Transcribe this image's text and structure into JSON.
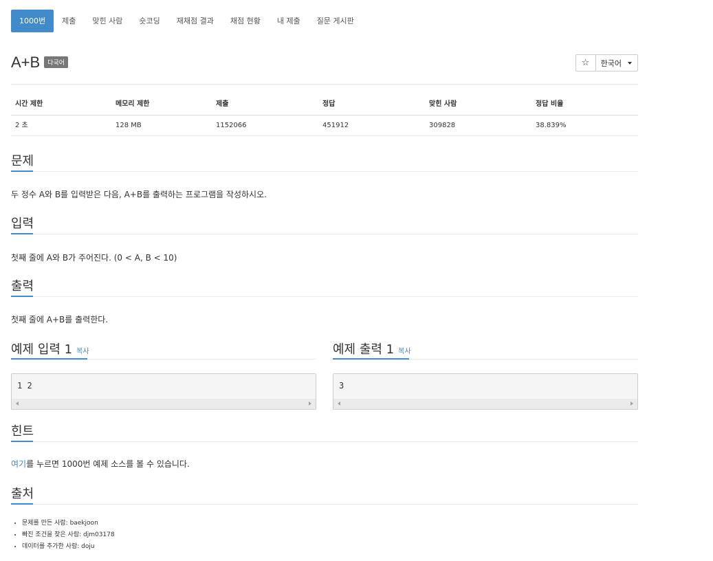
{
  "tabs": [
    {
      "label": "1000번",
      "active": true
    },
    {
      "label": "제출"
    },
    {
      "label": "맞힌 사람"
    },
    {
      "label": "숏코딩"
    },
    {
      "label": "재채점 결과"
    },
    {
      "label": "채점 현황"
    },
    {
      "label": "내 제출"
    },
    {
      "label": "질문 게시판"
    }
  ],
  "problem": {
    "title": "A+B",
    "badge": "다국어",
    "star_icon": "star-icon",
    "star_glyph": "☆",
    "language": "한국어"
  },
  "stats": {
    "headers": [
      "시간 제한",
      "메모리 제한",
      "제출",
      "정답",
      "맞힌 사람",
      "정답 비율"
    ],
    "values": [
      "2 초",
      "128 MB",
      "1152066",
      "451912",
      "309828",
      "38.839%"
    ]
  },
  "sections": {
    "problem": {
      "title": "문제",
      "text": "두 정수 A와 B를 입력받은 다음, A+B를 출력하는 프로그램을 작성하시오."
    },
    "input": {
      "title": "입력",
      "text": "첫째 줄에 A와 B가 주어진다. (0 < A, B < 10)"
    },
    "output": {
      "title": "출력",
      "text": "첫째 줄에 A+B를 출력한다."
    },
    "sample_input": {
      "title": "예제 입력 1",
      "copy": "복사",
      "content": "1 2"
    },
    "sample_output": {
      "title": "예제 출력 1",
      "copy": "복사",
      "content": "3"
    },
    "hint": {
      "title": "힌트",
      "link": "여기",
      "text": "를 누르면 1000번 예제 소스를 볼 수 있습니다."
    },
    "source": {
      "title": "출처",
      "items": [
        "문제를 만든 사람: baekjoon",
        "빠진 조건을 찾은 사람: djm03178",
        "데이터를 추가한 사람: doju"
      ]
    }
  },
  "colors": {
    "accent": "#428bca",
    "badge": "#777777"
  }
}
